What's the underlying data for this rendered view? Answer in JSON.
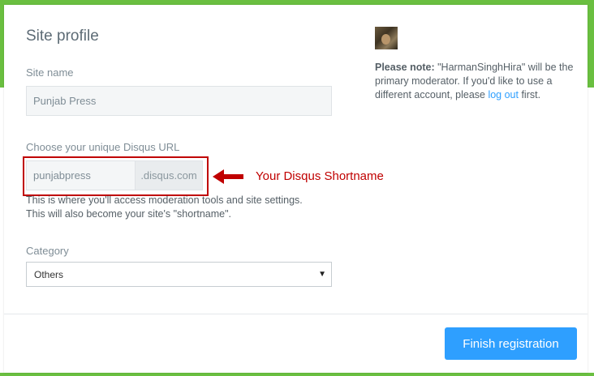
{
  "page": {
    "title": "Site profile"
  },
  "site_name": {
    "label": "Site name",
    "value": "Punjab Press"
  },
  "url": {
    "label": "Choose your unique Disqus URL",
    "value": "punjabpress",
    "suffix": ".disqus.com",
    "help_line1": "This is where you'll access moderation tools and site settings.",
    "help_line2": "This will also become your site's \"shortname\"."
  },
  "annotation": {
    "text": "Your Disqus Shortname",
    "color": "#c00000"
  },
  "category": {
    "label": "Category",
    "selected": "Others"
  },
  "note": {
    "bold": "Please note:",
    "text_before_link": " \"HarmanSinghHira\" will be the primary moderator. If you'd like to use a different account, please ",
    "link_text": "log out",
    "text_after_link": " first."
  },
  "actions": {
    "finish_label": "Finish registration"
  },
  "colors": {
    "accent_green": "#6abf40",
    "button_blue": "#2e9fff"
  }
}
